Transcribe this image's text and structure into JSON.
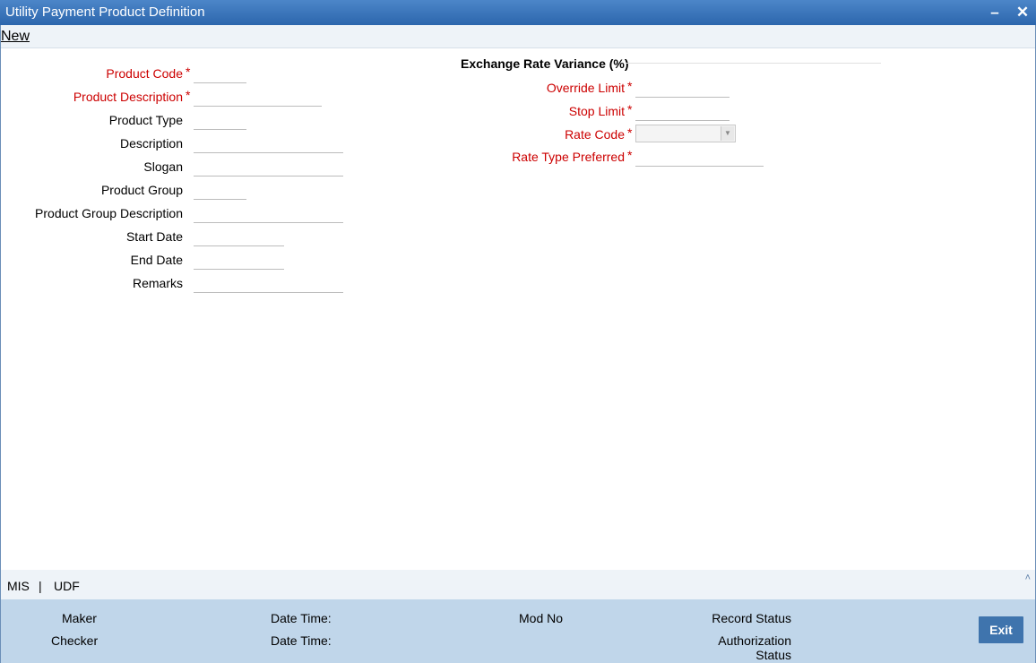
{
  "window": {
    "title": "Utility Payment Product Definition",
    "minimize_label": "–",
    "close_label": "✕"
  },
  "toolbar": {
    "new_label": "New"
  },
  "form_left": {
    "product_code": "Product Code",
    "product_description": "Product Description",
    "product_type": "Product Type",
    "description": "Description",
    "slogan": "Slogan",
    "product_group": "Product Group",
    "product_group_description": "Product Group Description",
    "start_date": "Start Date",
    "end_date": "End Date",
    "remarks": "Remarks"
  },
  "required_marker": "*",
  "exchange": {
    "section_title": "Exchange Rate Variance (%)",
    "override_limit": "Override Limit",
    "stop_limit": "Stop Limit",
    "rate_code": "Rate Code",
    "rate_type_preferred": "Rate Type Preferred",
    "select_arrow": "▼"
  },
  "tabs": {
    "mis": "MIS",
    "separator": "|",
    "udf": "UDF",
    "collapse_glyph": "˄"
  },
  "audit": {
    "maker": "Maker",
    "checker": "Checker",
    "date_time_1": "Date Time:",
    "date_time_2": "Date Time:",
    "mod_no": "Mod No",
    "record_status": "Record Status",
    "authorization": "Authorization",
    "status": "Status",
    "exit_label": "Exit"
  },
  "colors": {
    "title_bar": "#2c66ad",
    "required_label": "#cc0000",
    "audit_panel": "#c0d6ea",
    "exit_button": "#3f74ad"
  }
}
